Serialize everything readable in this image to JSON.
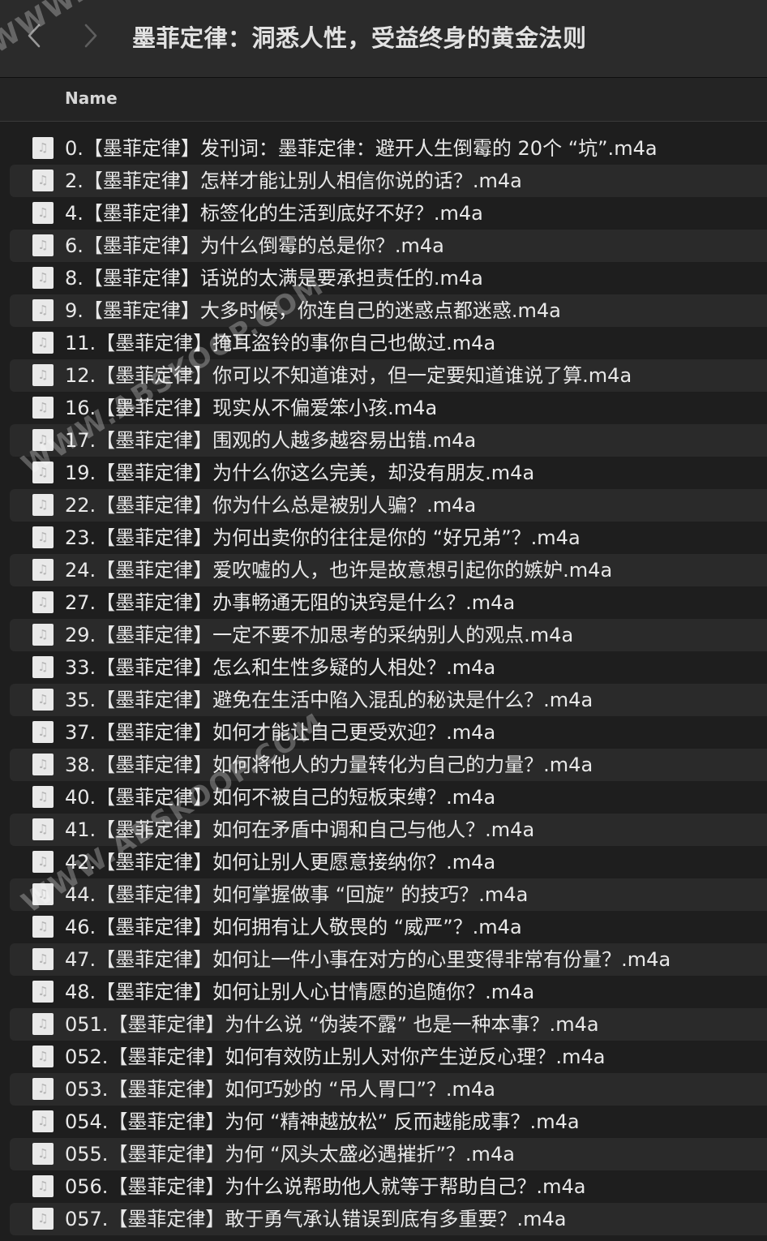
{
  "window": {
    "title": "墨菲定律：洞悉人性，受益终身的黄金法则",
    "back_icon": "chevron-left-icon",
    "forward_icon": "chevron-right-icon"
  },
  "header": {
    "name_column": "Name"
  },
  "files": [
    {
      "name": "0.【墨菲定律】发刊词：墨菲定律：避开人生倒霉的 20个 “坑”.m4a"
    },
    {
      "name": "2.【墨菲定律】怎样才能让别人相信你说的话？.m4a"
    },
    {
      "name": "4.【墨菲定律】标签化的生活到底好不好？.m4a"
    },
    {
      "name": "6.【墨菲定律】为什么倒霉的总是你？.m4a"
    },
    {
      "name": "8.【墨菲定律】话说的太满是要承担责任的.m4a"
    },
    {
      "name": "9.【墨菲定律】大多时候，你连自己的迷惑点都迷惑.m4a"
    },
    {
      "name": "11.【墨菲定律】掩耳盗铃的事你自己也做过.m4a"
    },
    {
      "name": "12.【墨菲定律】你可以不知道谁对，但一定要知道谁说了算.m4a"
    },
    {
      "name": "16.【墨菲定律】现实从不偏爱笨小孩.m4a"
    },
    {
      "name": "17.【墨菲定律】围观的人越多越容易出错.m4a"
    },
    {
      "name": "19.【墨菲定律】为什么你这么完美，却没有朋友.m4a"
    },
    {
      "name": "22.【墨菲定律】你为什么总是被别人骗？.m4a"
    },
    {
      "name": "23.【墨菲定律】为何出卖你的往往是你的 “好兄弟”？.m4a"
    },
    {
      "name": "24.【墨菲定律】爱吹嘘的人，也许是故意想引起你的嫉妒.m4a"
    },
    {
      "name": "27.【墨菲定律】办事畅通无阻的诀窍是什么？.m4a"
    },
    {
      "name": "29.【墨菲定律】一定不要不加思考的采纳别人的观点.m4a"
    },
    {
      "name": "33.【墨菲定律】怎么和生性多疑的人相处？.m4a"
    },
    {
      "name": "35.【墨菲定律】避免在生活中陷入混乱的秘诀是什么？.m4a"
    },
    {
      "name": "37.【墨菲定律】如何才能让自己更受欢迎？.m4a"
    },
    {
      "name": "38.【墨菲定律】如何将他人的力量转化为自己的力量？.m4a"
    },
    {
      "name": "40.【墨菲定律】如何不被自己的短板束缚？.m4a"
    },
    {
      "name": "41.【墨菲定律】如何在矛盾中调和自己与他人？.m4a"
    },
    {
      "name": "42.【墨菲定律】如何让别人更愿意接纳你？.m4a"
    },
    {
      "name": "44.【墨菲定律】如何掌握做事 “回旋” 的技巧？.m4a"
    },
    {
      "name": "46.【墨菲定律】如何拥有让人敬畏的 “威严”？.m4a"
    },
    {
      "name": "47.【墨菲定律】如何让一件小事在对方的心里变得非常有份量？.m4a"
    },
    {
      "name": "48.【墨菲定律】如何让别人心甘情愿的追随你？.m4a"
    },
    {
      "name": "051.【墨菲定律】为什么说 “伪装不露” 也是一种本事？.m4a"
    },
    {
      "name": "052.【墨菲定律】如何有效防止别人对你产生逆反心理？.m4a"
    },
    {
      "name": "053.【墨菲定律】如何巧妙的 “吊人胃口”？.m4a"
    },
    {
      "name": "054.【墨菲定律】为何 “精神越放松” 反而越能成事？.m4a"
    },
    {
      "name": "055.【墨菲定律】为何 “风头太盛必遇摧折”？.m4a"
    },
    {
      "name": "056.【墨菲定律】为什么说帮助他人就等于帮助自己？.m4a"
    },
    {
      "name": "057.【墨菲定律】敢于勇气承认错误到底有多重要？.m4a"
    }
  ],
  "file_icon": "audio-file-icon",
  "watermark": {
    "text": "WWW.ABSKOOP.COM"
  }
}
